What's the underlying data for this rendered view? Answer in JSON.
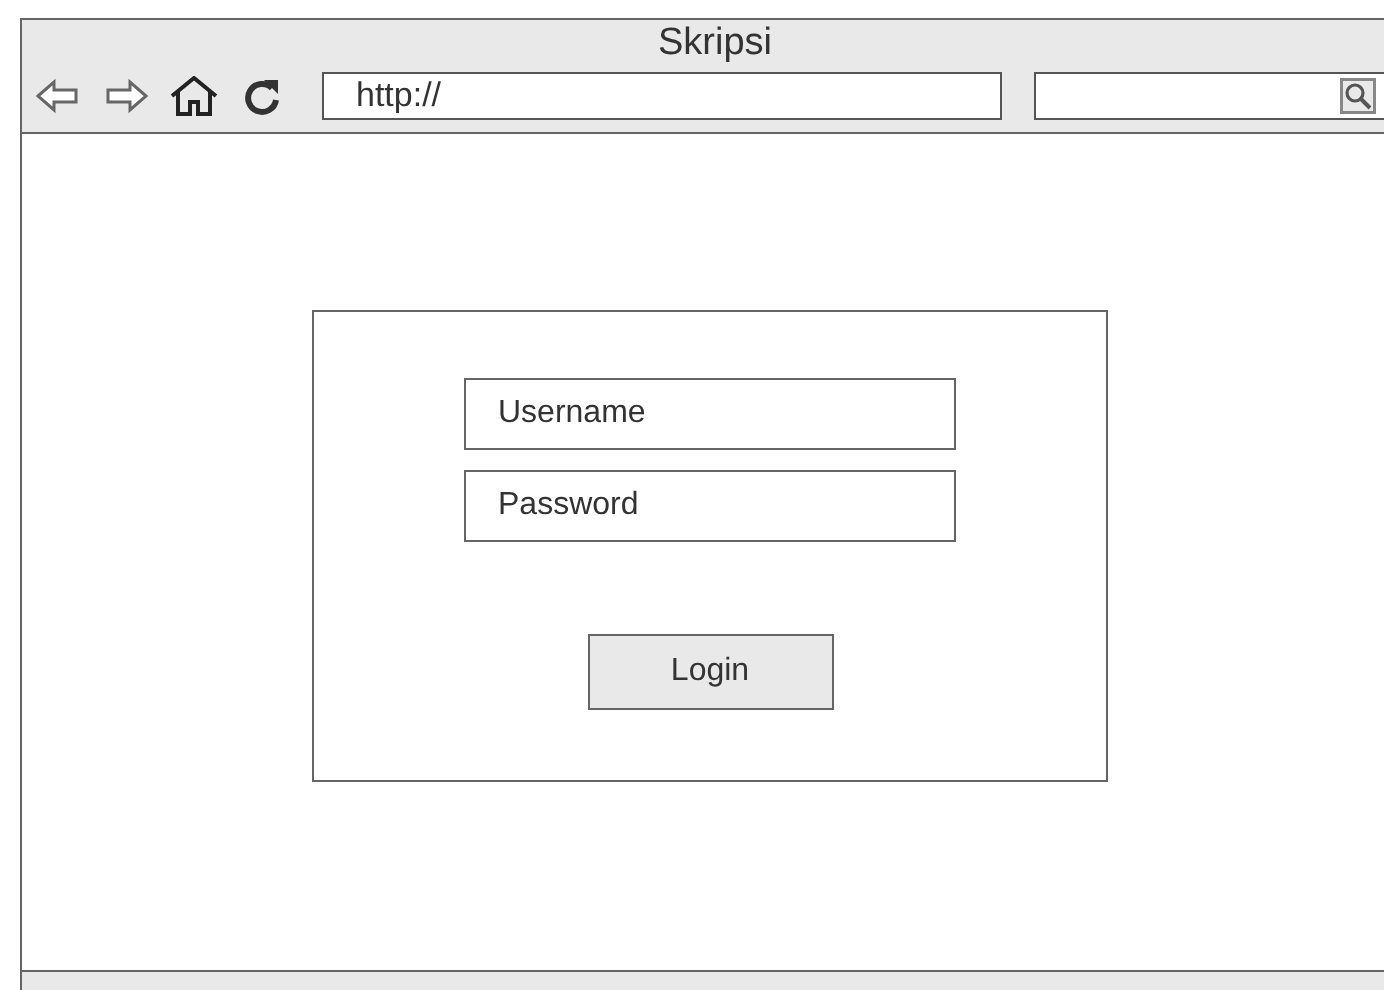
{
  "window": {
    "title": "Skripsi"
  },
  "toolbar": {
    "url": "http://"
  },
  "login": {
    "fields": [
      {
        "placeholder": "Username"
      },
      {
        "placeholder": "Password"
      }
    ],
    "button": "Login"
  }
}
